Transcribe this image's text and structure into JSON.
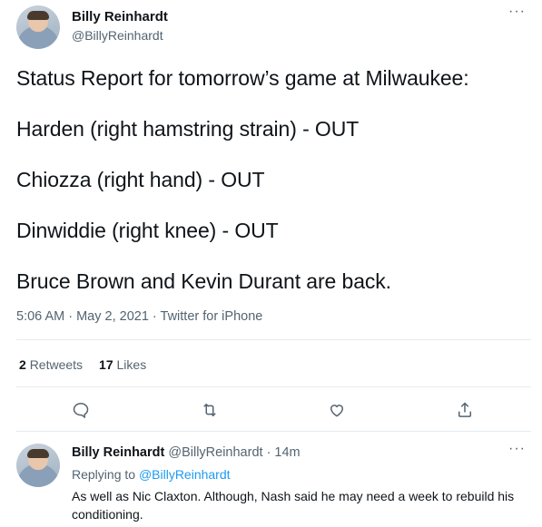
{
  "tweet": {
    "author_name": "Billy Reinhardt",
    "author_handle": "@BillyReinhardt",
    "more_label": "···",
    "lines": [
      "Status Report for tomorrow’s game at Milwaukee:",
      "Harden (right hamstring strain) - OUT",
      "Chiozza (right hand) - OUT",
      "Dinwiddie (right knee) - OUT",
      "Bruce Brown and Kevin Durant are back."
    ],
    "meta": "5:06 AM · May 2, 2021 · Twitter for iPhone",
    "retweets_count": "2",
    "retweets_label": "Retweets",
    "likes_count": "17",
    "likes_label": "Likes",
    "actions": {
      "reply_icon": "reply-icon",
      "retweet_icon": "retweet-icon",
      "like_icon": "like-icon",
      "share_icon": "share-icon"
    }
  },
  "reply": {
    "author_name": "Billy Reinhardt",
    "author_meta": "@BillyReinhardt · 14m",
    "more_label": "···",
    "replying_to_prefix": "Replying to",
    "replying_to_handle": "@BillyReinhardt",
    "text": "As well as Nic Claxton. Although, Nash said he may need a week to rebuild his conditioning."
  },
  "colors": {
    "text": "#0f1419",
    "secondary": "#536471",
    "link": "#1d9bf0",
    "divider": "#e6ecf0"
  }
}
